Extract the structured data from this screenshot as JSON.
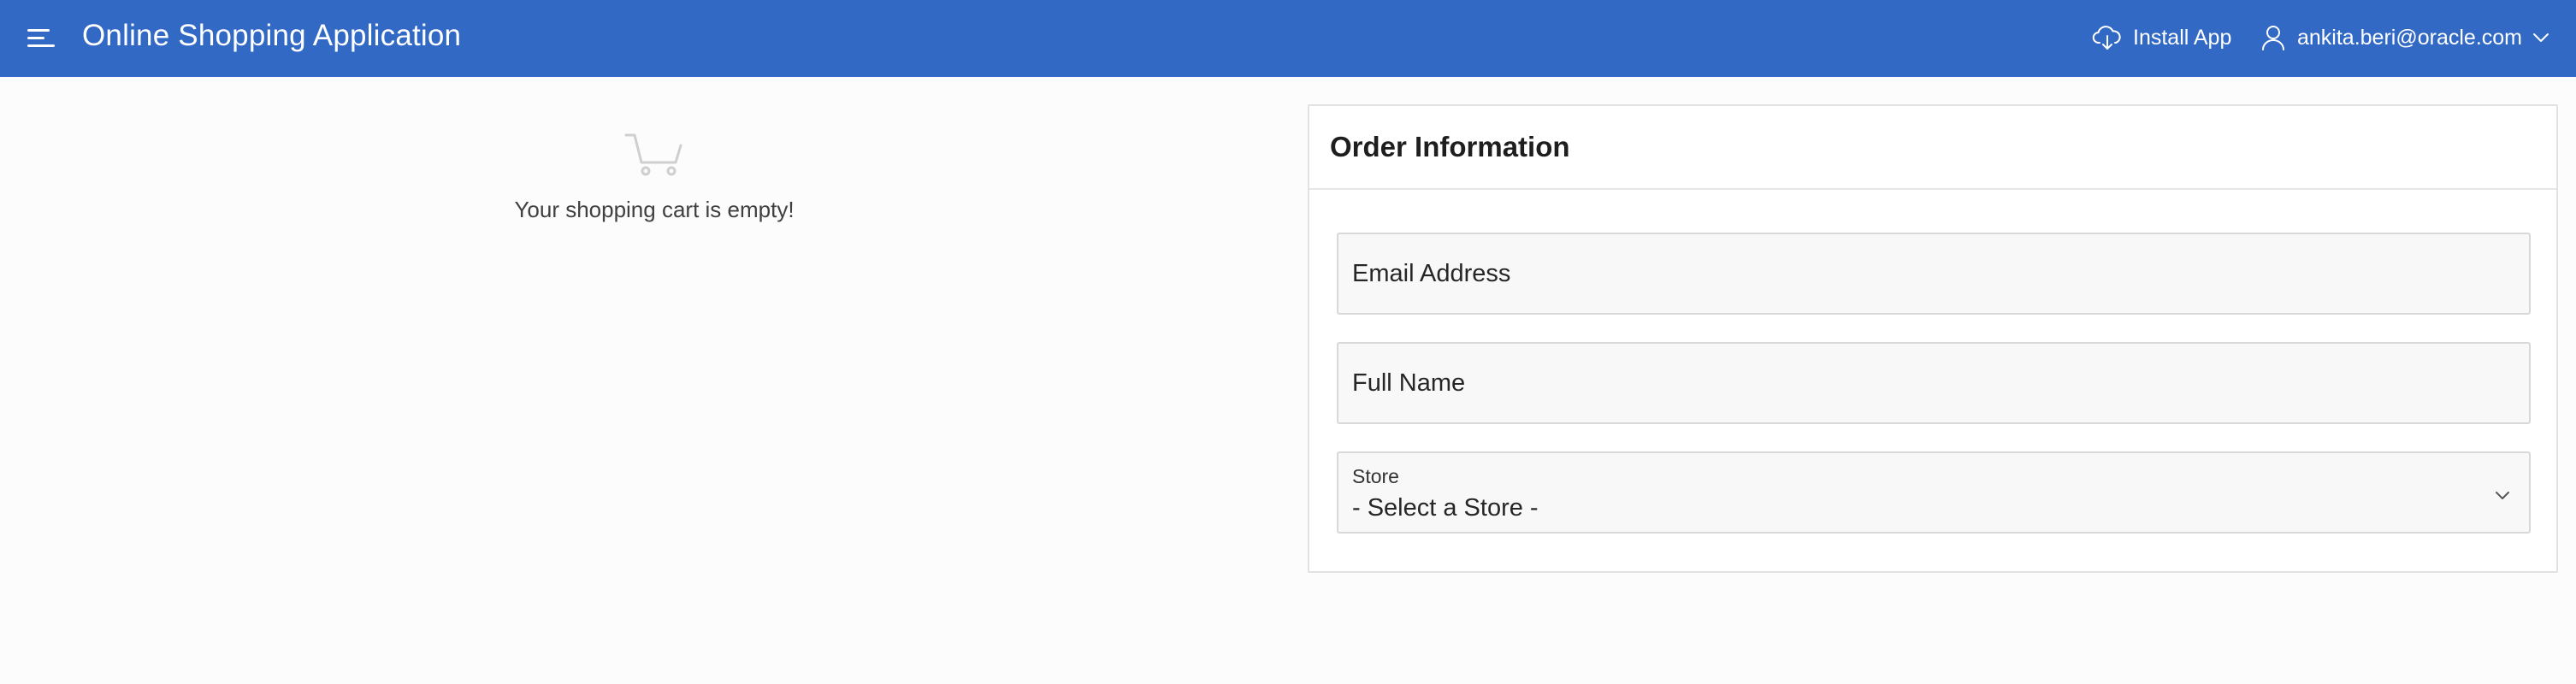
{
  "header": {
    "app_title": "Online Shopping Application",
    "install_app_label": "Install App",
    "user_email": "ankita.beri@oracle.com",
    "background_color": "#3169c4"
  },
  "cart": {
    "empty_message": "Your shopping cart is empty!"
  },
  "order": {
    "title": "Order Information",
    "email_placeholder": "Email Address",
    "full_name_placeholder": "Full Name",
    "store_label": "Store",
    "store_selected": "- Select a Store -"
  },
  "icons": {
    "menu": "hamburger-menu-icon",
    "install": "cloud-download-icon",
    "user": "user-icon",
    "dropdown": "chevron-down-icon",
    "cart": "shopping-cart-icon"
  }
}
